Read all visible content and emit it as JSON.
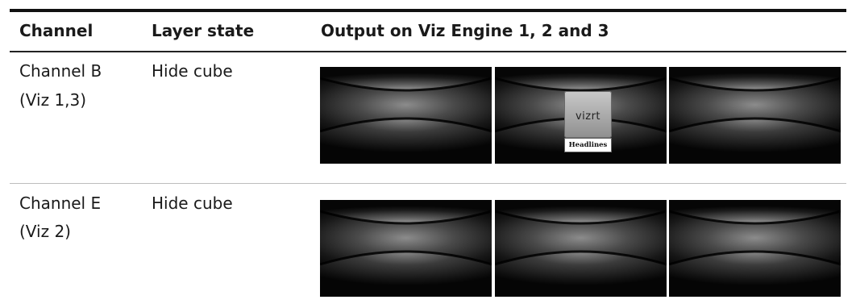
{
  "table": {
    "headers": {
      "channel": "Channel",
      "layer_state": "Layer state",
      "output": "Output on Viz Engine 1, 2 and 3"
    },
    "rows": [
      {
        "channel_line1": "Channel B",
        "channel_line2": "(Viz 1,3)",
        "layer_state": "Hide cube",
        "outputs": [
          {
            "shows_cube": false
          },
          {
            "shows_cube": true,
            "cube_logo": "vizrt",
            "cube_label": "Headlines"
          },
          {
            "shows_cube": false
          }
        ]
      },
      {
        "channel_line1": "Channel E",
        "channel_line2": "(Viz 2)",
        "layer_state": "Hide cube",
        "outputs": [
          {
            "shows_cube": false
          },
          {
            "shows_cube": false
          },
          {
            "shows_cube": false
          }
        ]
      }
    ]
  }
}
